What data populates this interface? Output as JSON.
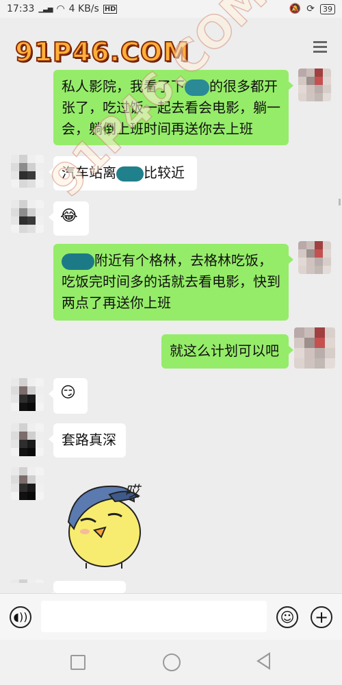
{
  "status_bar": {
    "time": "17:33",
    "signal": "▮▮▮",
    "net_speed": "4 KB/s",
    "hd": "HD",
    "battery": "39"
  },
  "watermark": {
    "top": "91P46.COM",
    "diagonal": "91P46.COM"
  },
  "messages": [
    {
      "side": "me",
      "text_before": "私人影院，我看了下",
      "text_after": "的很多都开张了，吃过饭一起去看会电影，躺一会，躺倒上班时间再送你去上班"
    },
    {
      "side": "them",
      "text": "汽车站离",
      "text_after": "比较近"
    },
    {
      "side": "them",
      "emoji": "😂"
    },
    {
      "side": "me",
      "text": "附近有个格林，去格林吃饭，吃饭完时间多的话就去看电影，快到两点了再送你上班"
    },
    {
      "side": "me",
      "text": "就这么计划可以吧"
    },
    {
      "side": "them",
      "emoji": "😏"
    },
    {
      "side": "them",
      "text": "套路真深"
    },
    {
      "side": "them",
      "sticker_text": "哎"
    }
  ],
  "input_bar": {
    "voice_icon": "voice-icon",
    "emoji_icon": "emoji-icon",
    "plus_icon": "plus-icon"
  }
}
